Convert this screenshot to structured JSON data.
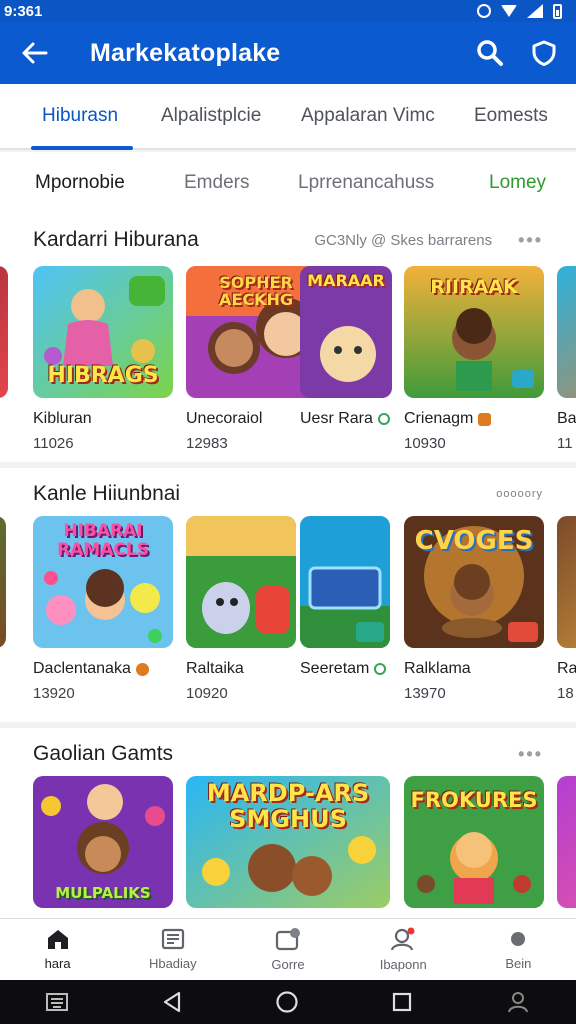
{
  "status": {
    "time": "9:361"
  },
  "appbar": {
    "title": "Markekatoplake",
    "icons": [
      "back-arrow-icon",
      "search-icon",
      "shield-icon"
    ]
  },
  "tabs": [
    {
      "label": "Hiburasn",
      "active": true
    },
    {
      "label": "Alpalistplcie",
      "active": false
    },
    {
      "label": "Appalaran Vimc",
      "active": false
    },
    {
      "label": "Eomests",
      "active": false
    }
  ],
  "chips": [
    {
      "label": "Mpornobie",
      "state": "selected"
    },
    {
      "label": "Emders",
      "state": "normal"
    },
    {
      "label": "Lprrenancahuss",
      "state": "normal"
    },
    {
      "label": "Lomey",
      "state": "accent"
    }
  ],
  "sections": [
    {
      "title": "Kardarri Hiburana",
      "subtitle": "GC3Nly @ Skes barrarens",
      "items": [
        {
          "name": "Kibluran",
          "count": "11026",
          "badge": "",
          "art": "HIBRAGS"
        },
        {
          "name": "Unecoraiol",
          "count": "12983",
          "badge": "",
          "art": "SOPHER AECKHG"
        },
        {
          "name": "Uesr Rara",
          "count": "",
          "badge": "verified",
          "art": "MARAAR"
        },
        {
          "name": "Crienagm",
          "count": "10930",
          "badge": "orange",
          "art": "RIIRAAK"
        },
        {
          "name": "Ba",
          "count": "11",
          "badge": "",
          "art": ""
        }
      ]
    },
    {
      "title": "Kanle Hiiunbnai",
      "subtitle": "ooooory",
      "items": [
        {
          "name": "Daclentanaka",
          "count": "13920",
          "badge": "orange",
          "art": "HIBARAI RAMACLS"
        },
        {
          "name": "Raltaika",
          "count": "10920",
          "badge": "",
          "art": ""
        },
        {
          "name": "Seeretam",
          "count": "",
          "badge": "verified",
          "art": ""
        },
        {
          "name": "Ralklama",
          "count": "13970",
          "badge": "",
          "art": "CVOGES"
        },
        {
          "name": "Ra",
          "count": "18",
          "badge": "",
          "art": ""
        }
      ]
    },
    {
      "title": "Gaolian Gamts",
      "subtitle": "",
      "items": [
        {
          "name": "",
          "count": "",
          "badge": "",
          "art": "MULPALIKS"
        },
        {
          "name": "",
          "count": "",
          "badge": "",
          "art": "MARDP-ARS SMGHUS"
        },
        {
          "name": "",
          "count": "",
          "badge": "",
          "art": "FROKURES"
        }
      ]
    }
  ],
  "bottom_nav": [
    {
      "label": "hara",
      "icon": "home-icon",
      "active": true
    },
    {
      "label": "Hbadiay",
      "icon": "news-icon",
      "active": false
    },
    {
      "label": "Gorre",
      "icon": "game-icon",
      "active": false
    },
    {
      "label": "Ibaponn",
      "icon": "profile-icon",
      "active": false
    },
    {
      "label": "Bein",
      "icon": "dot-icon",
      "active": false
    }
  ],
  "colors": {
    "primary": "#0b5ad0",
    "accent_green": "#2f9a2f",
    "verified": "#36a35b",
    "badge_orange": "#e07a22"
  }
}
